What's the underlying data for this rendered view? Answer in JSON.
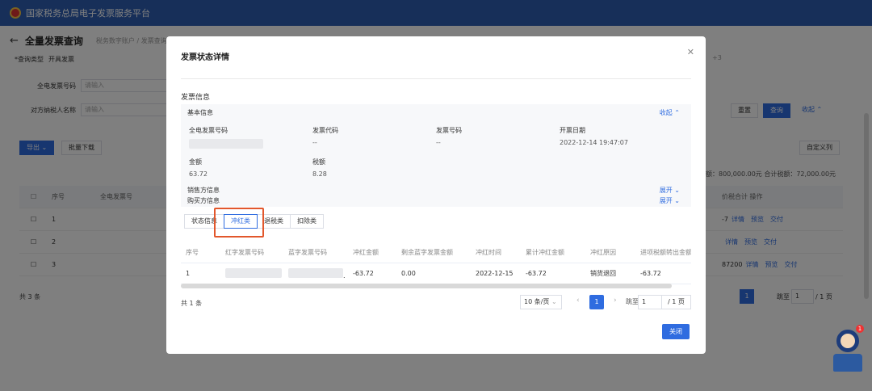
{
  "app": {
    "title": "国家税务总局电子发票服务平台"
  },
  "page": {
    "title": "全量发票查询",
    "breadcrumb": "税务数字账户 / 发票查询",
    "form": [
      {
        "label": "*查询类型",
        "value": "开具发票"
      },
      {
        "label": "全电发票号码",
        "value": "请输入"
      },
      {
        "label": "对方纳税人名称",
        "value": "请输入"
      }
    ],
    "export_label": "导出 ⌄",
    "batch_download_label": "批量下载",
    "reset_label": "重置",
    "query_label": "查询",
    "collapse_label": "收起 ⌃",
    "custom_cols_label": "自定义列",
    "summary": "额：800,000.00元   合计税额：72,000.00元",
    "plus_badge": "+3",
    "table_head": {
      "index": "序号",
      "number": "全电发票号",
      "tax_total": "价税合计",
      "ops": "操作"
    },
    "rows": [
      {
        "index": "1",
        "amount": "-7",
        "ops": [
          "详情",
          "预览",
          "交付"
        ]
      },
      {
        "index": "2",
        "amount": "",
        "ops": [
          "详情",
          "预览",
          "交付"
        ]
      },
      {
        "index": "3",
        "amount": "87200",
        "ops": [
          "详情",
          "预览",
          "交付"
        ]
      }
    ],
    "total": "共 3 条",
    "jump_label": "跳至",
    "jump_value": "1",
    "pages_label": "/ 1 页",
    "current_page": "1",
    "assistant_badge": "1"
  },
  "modal": {
    "title": "发票状态详情",
    "section": "发票信息",
    "basic_info": "基本信息",
    "collapse": "收起 ⌃",
    "fields": {
      "fulldigital_no_label": "全电发票号码",
      "code_label": "发票代码",
      "code_value": "--",
      "number_label": "发票号码",
      "number_value": "--",
      "date_label": "开票日期",
      "date_value": "2022-12-14 19:47:07",
      "amount_label": "金额",
      "amount_value": "63.72",
      "tax_label": "税额",
      "tax_value": "8.28"
    },
    "seller_label": "销售方信息",
    "buyer_label": "购买方信息",
    "expand": "展开 ⌄",
    "tabs": [
      "状态信息",
      "冲红类",
      "退税类",
      "扣除类"
    ],
    "active_tab": "冲红类",
    "table": {
      "headers": [
        "序号",
        "红字发票号码",
        "蓝字发票号码",
        "冲红金额",
        "剩余蓝字发票金额",
        "冲红时间",
        "累计冲红金额",
        "冲红原因",
        "进项税额转出金额"
      ],
      "rows": [
        [
          "1",
          "",
          ".",
          "-63.72",
          "0.00",
          "2022-12-15",
          "-63.72",
          "销货退回",
          "-63.72"
        ]
      ]
    },
    "total": "共 1 条",
    "page_size": "10 条/页",
    "current_page": "1",
    "jump_label": "跳至",
    "jump_value": "1",
    "pages_label": "/ 1 页",
    "close_label": "关闭"
  }
}
